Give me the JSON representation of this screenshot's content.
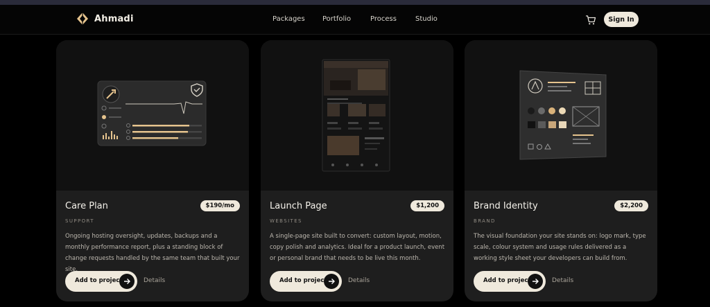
{
  "brand": {
    "name": "Ahmadi",
    "logo_icon": "diamond-logo-icon"
  },
  "nav": {
    "links": [
      "Packages",
      "Portfolio",
      "Process",
      "Studio"
    ]
  },
  "header": {
    "cart_icon": "cart-icon",
    "signin_label": "Sign In"
  },
  "colors": {
    "accent": "#efe9dc",
    "gold": "#d9b27a",
    "card_bg": "#1e1e1e",
    "page_bg": "#000000"
  },
  "cards": [
    {
      "title": "Care Plan",
      "price": "$190/mo",
      "category": "SUPPORT",
      "description": "Ongoing hosting oversight, updates, backups and a monthly performance report, plus a standing block of change requests handled by the same team that built your site.",
      "add_label": "Add to project",
      "details_label": "Details"
    },
    {
      "title": "Launch Page",
      "price": "$1,200",
      "category": "WEBSITES",
      "description": "A single-page site built to convert: custom layout, motion, copy polish and analytics. Ideal for a product launch, event or personal brand that needs to be live this month.",
      "add_label": "Add to project",
      "details_label": "Details"
    },
    {
      "title": "Brand Identity",
      "price": "$2,200",
      "category": "BRAND",
      "description": "The visual foundation your site stands on: logo mark, type scale, colour system and usage rules delivered as a working style sheet your developers can build from.",
      "add_label": "Add to project",
      "details_label": "Details"
    }
  ]
}
